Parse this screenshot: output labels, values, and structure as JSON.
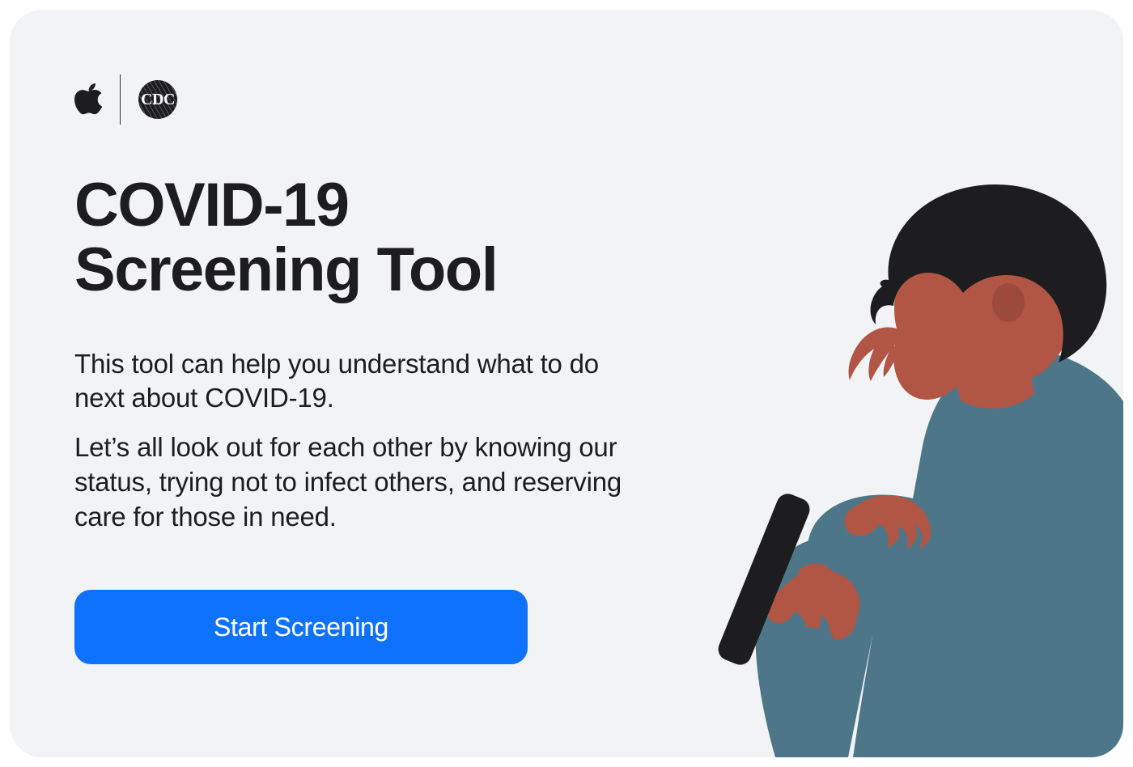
{
  "logos": {
    "apple_name": "apple-logo",
    "cdc_name": "cdc-logo",
    "cdc_text": "CDC"
  },
  "hero": {
    "title_line1": "COVID-19",
    "title_line2": "Screening Tool",
    "paragraph1": "This tool can help you understand what to do next about COVID-19.",
    "paragraph2": "Let’s all look out for each other by knowing our status, trying not to infect others, and reserving care for those in need."
  },
  "cta": {
    "label": "Start Screening"
  },
  "colors": {
    "background": "#f2f3f5",
    "text": "#1d1d1f",
    "primary_button": "#0f72ff",
    "skin": "#b15544",
    "hair": "#1d1d1f",
    "shirt": "#4d7788",
    "phone": "#1d1d1f"
  }
}
